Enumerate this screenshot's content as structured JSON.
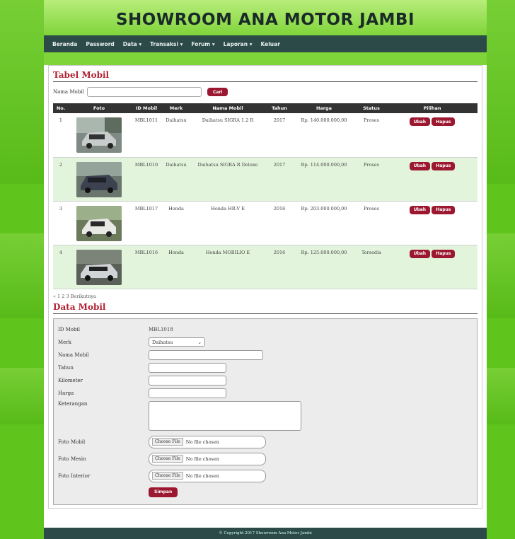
{
  "site_title": "SHOWROOM ANA MOTOR JAMBI",
  "menu": [
    "Beranda",
    "Password",
    "Data ▾",
    "Transaksi ▾",
    "Forum ▾",
    "Laporan ▾",
    "Keluar"
  ],
  "table_section": {
    "title": "Tabel Mobil",
    "search_label": "Nama Mobil",
    "search_value": "",
    "search_button": "Cari",
    "columns": [
      "No.",
      "Foto",
      "ID Mobil",
      "Merk",
      "Nama Mobil",
      "Tahun",
      "Harga",
      "Status",
      "Pilihan"
    ],
    "rows": [
      {
        "no": "1",
        "id": "MBL1011",
        "merk": "Daihatsu",
        "nama": "Daihatsu SIGRA 1.2 R",
        "tahun": "2017",
        "harga": "Rp. 140.000.000,00",
        "status": "Proses"
      },
      {
        "no": "2",
        "id": "MBL1010",
        "merk": "Daihatsu",
        "nama": "Daihatsu SIGRA R Deluxe",
        "tahun": "2017",
        "harga": "Rp. 114.000.000,00",
        "status": "Proses"
      },
      {
        "no": "3",
        "id": "MBL1017",
        "merk": "Honda",
        "nama": "Honda HR-V E",
        "tahun": "2016",
        "harga": "Rp. 203.000.000,00",
        "status": "Proses"
      },
      {
        "no": "4",
        "id": "MBL1016",
        "merk": "Honda",
        "nama": "Honda MOBILIO E",
        "tahun": "2016",
        "harga": "Rp. 125.000.000,00",
        "status": "Tersedia"
      }
    ],
    "edit_label": "Ubah",
    "delete_label": "Hapus",
    "pager": "« 1 2 3 Berikutnya"
  },
  "form_section": {
    "title": "Data Mobil",
    "id_label": "ID Mobil",
    "id_value": "MBL1018",
    "merk_label": "Merk",
    "merk_value": "Daihatsu",
    "nama_label": "Nama Mobil",
    "tahun_label": "Tahun",
    "kilometer_label": "Kilometer",
    "harga_label": "Harga",
    "keterangan_label": "Keterangan",
    "foto_mobil_label": "Foto Mobil",
    "foto_mesin_label": "Foto Mesin",
    "foto_interior_label": "Foto Interior",
    "file_button": "Choose File",
    "file_status": "No file chosen",
    "submit_label": "Simpan"
  },
  "footer": "© Copyright 2017 Showroom Ana Motor Jambi",
  "colors": {
    "menu_bg": "#2c4a48",
    "accent": "#9c1830",
    "page_bg": "#5fc41c"
  }
}
